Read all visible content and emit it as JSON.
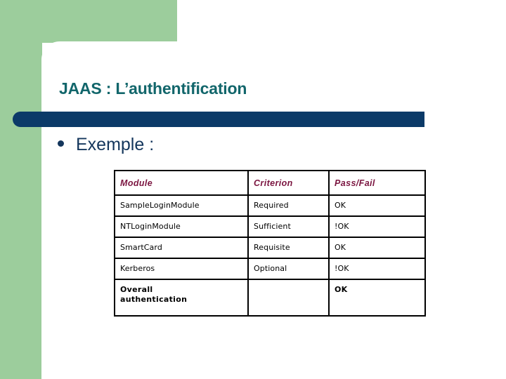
{
  "slide": {
    "title": "JAAS : L’authentification",
    "bullet_label": "Exemple :",
    "bullet_marker": "bullet-dot"
  },
  "colors": {
    "green_accent": "#9ccd9c",
    "title_teal": "#12666b",
    "divider_navy": "#0b3a68",
    "bullet_navy": "#14365c",
    "table_header_maroon": "#7b1540",
    "table_border": "#000000",
    "body_text": "#000000",
    "panel_white": "#ffffff"
  },
  "table": {
    "columns": [
      "Module",
      "Criterion",
      "Pass/Fail"
    ],
    "rows": [
      {
        "module": "SampleLoginModule",
        "criterion": "Required",
        "pass_fail": "OK"
      },
      {
        "module": "NTLoginModule",
        "criterion": "Sufficient",
        "pass_fail": "!OK"
      },
      {
        "module": "SmartCard",
        "criterion": "Requisite",
        "pass_fail": "OK"
      },
      {
        "module": "Kerberos",
        "criterion": "Optional",
        "pass_fail": "!OK"
      }
    ],
    "summary": {
      "module": "Overall\nauthentication",
      "criterion": "",
      "pass_fail": "OK"
    }
  }
}
